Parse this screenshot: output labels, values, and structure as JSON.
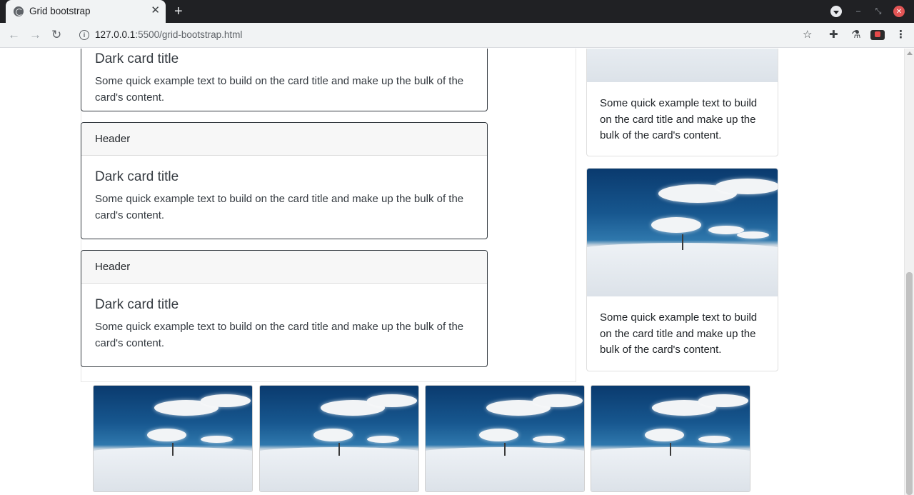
{
  "browser": {
    "tab_title": "Grid bootstrap",
    "tab_close": "✕",
    "new_tab": "+",
    "url_host": "127.0.0.1",
    "url_path": ":5500/grid-bootstrap.html",
    "back": "←",
    "forward": "→",
    "reload": "↻",
    "info": "i",
    "star": "☆",
    "extensions": "✚",
    "labs": "⚗",
    "kebab": "⋮",
    "minimize": "‒",
    "restore": "⤡",
    "close": "✕"
  },
  "cards": [
    {
      "header": "",
      "title": "Dark card title",
      "text": "Some quick example text to build on the card title and make up the bulk of the card's content."
    },
    {
      "header": "Header",
      "title": "Dark card title",
      "text": "Some quick example text to build on the card title and make up the bulk of the card's content."
    },
    {
      "header": "Header",
      "title": "Dark card title",
      "text": "Some quick example text to build on the card title and make up the bulk of the card's content."
    }
  ],
  "image_cards": [
    {
      "text": "Some quick example text to build on the card title and make up the bulk of the card's content."
    },
    {
      "text": "Some quick example text to build on the card title and make up the bulk of the card's content."
    }
  ],
  "colors": {
    "card_border": "#343a40",
    "tabbar": "#202124",
    "toolbar": "#f1f3f4"
  }
}
